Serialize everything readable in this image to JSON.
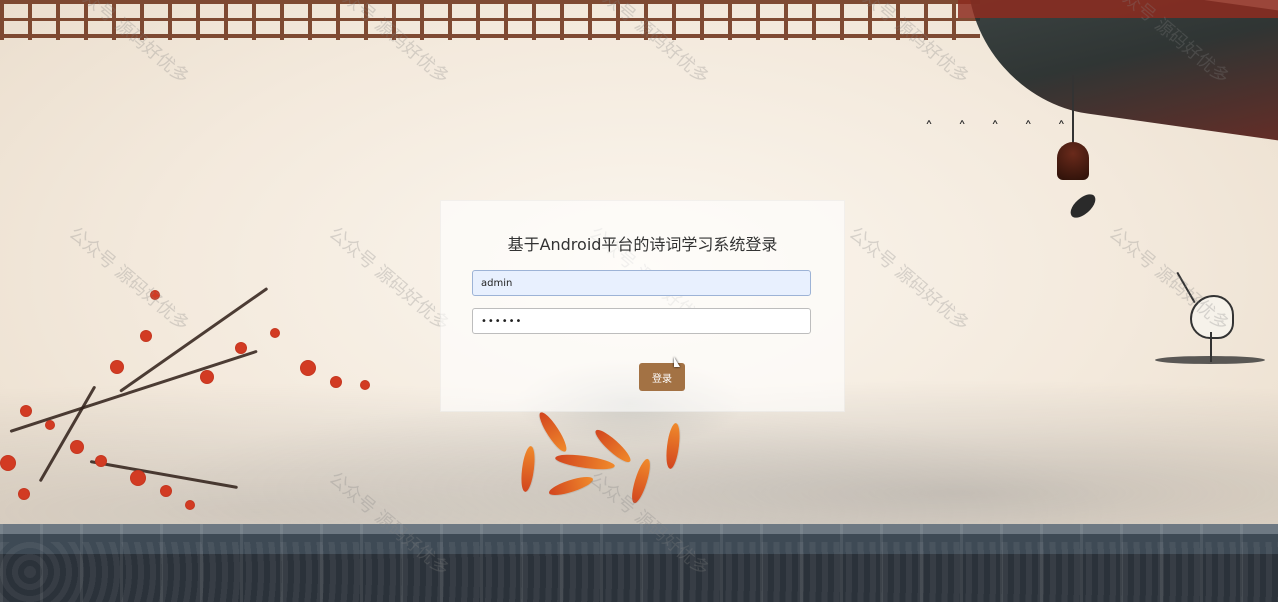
{
  "login": {
    "title": "基于Android平台的诗词学习系统登录",
    "username_value": "admin",
    "password_value": "••••••",
    "login_button_label": "登录"
  },
  "watermarks": [
    "公众号 源码好优多",
    "公众号 源码好优多",
    "公众号 源码好优多",
    "公众号 源码好优多",
    "公众号 源码好优多",
    "公众号 源码好优多",
    "公众号 源码好优多",
    "公众号 源码好优多",
    "公众号 源码好优多",
    "公众号 源码好优多",
    "公众号 源码好优多",
    "公众号 源码好优多"
  ],
  "colors": {
    "login_button": "#a37244",
    "username_field_bg": "#e8f0fe"
  },
  "icons": {
    "cursor": "cursor-icon",
    "decorations": [
      "lattice-pattern",
      "eave",
      "bell-icon",
      "crane-icon",
      "koi-fish",
      "plum-blossom",
      "roof-tiles"
    ]
  }
}
